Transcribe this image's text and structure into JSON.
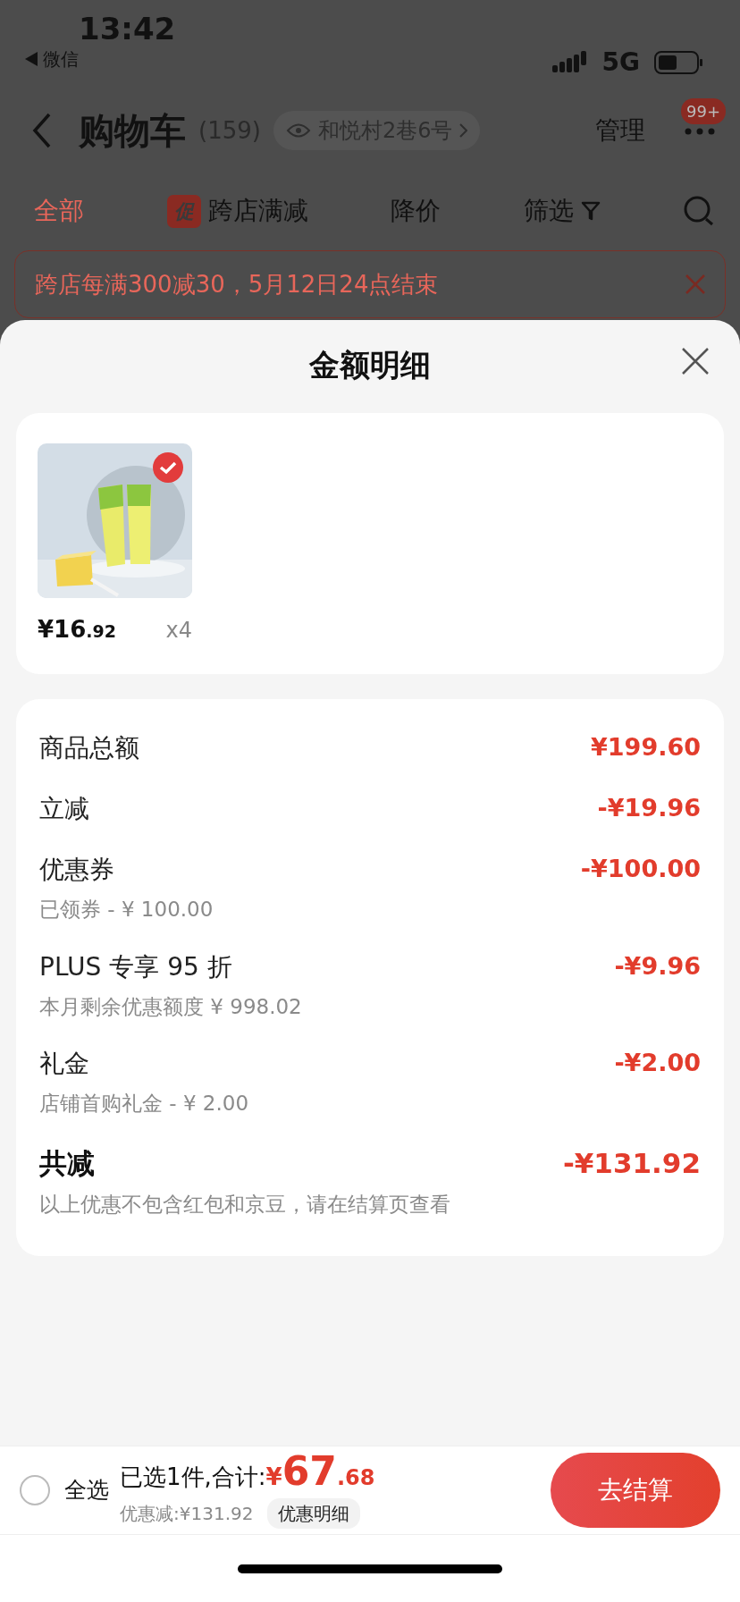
{
  "status_bar": {
    "time": "13:42",
    "back_app": "微信",
    "network": "5G"
  },
  "nav": {
    "title": "购物车",
    "count": "(159)",
    "address": "和悦村2巷6号",
    "manage": "管理",
    "badge": "99+"
  },
  "filter_tabs": [
    {
      "label": "全部",
      "selected": true
    },
    {
      "label": "跨店满减",
      "tag": "促",
      "selected": false
    },
    {
      "label": "降价",
      "selected": false
    },
    {
      "label": "筛选",
      "kind": "filter",
      "selected": false
    }
  ],
  "promo_banner": "跨店每满300减30，5月12日24点结束",
  "sheet": {
    "title": "金额明细",
    "items": [
      {
        "kind": "picture",
        "checked": true,
        "price": "¥16",
        "price_decimal": ".92",
        "quantity": "x4"
      }
    ],
    "breakdown": [
      {
        "label": "商品总额",
        "amount": "¥199.60"
      },
      {
        "label": "立减",
        "amount": "-¥19.96"
      },
      {
        "label": "优惠券",
        "sublabel": "已领券 - ¥ 100.00",
        "amount": "-¥100.00"
      },
      {
        "label": "PLUS 专享 95 折",
        "sublabel": "本月剩余优惠额度 ¥ 998.02",
        "amount": "-¥9.96"
      },
      {
        "label": "礼金",
        "sublabel": "店铺首购礼金 - ¥ 2.00",
        "amount": "-¥2.00"
      }
    ],
    "total": {
      "label": "共减",
      "amount": "-¥131.92",
      "note": "以上优惠不包含红包和京豆，请在结算页查看"
    }
  },
  "bottom_bar": {
    "select_all": {
      "label": "全选",
      "checked": false
    },
    "summary": "已选1件,合计:",
    "currency": "¥",
    "total": "67",
    "total_decimal": ".68",
    "discount": "优惠减:¥131.92",
    "details_button": "优惠明细",
    "checkout": "去结算"
  }
}
